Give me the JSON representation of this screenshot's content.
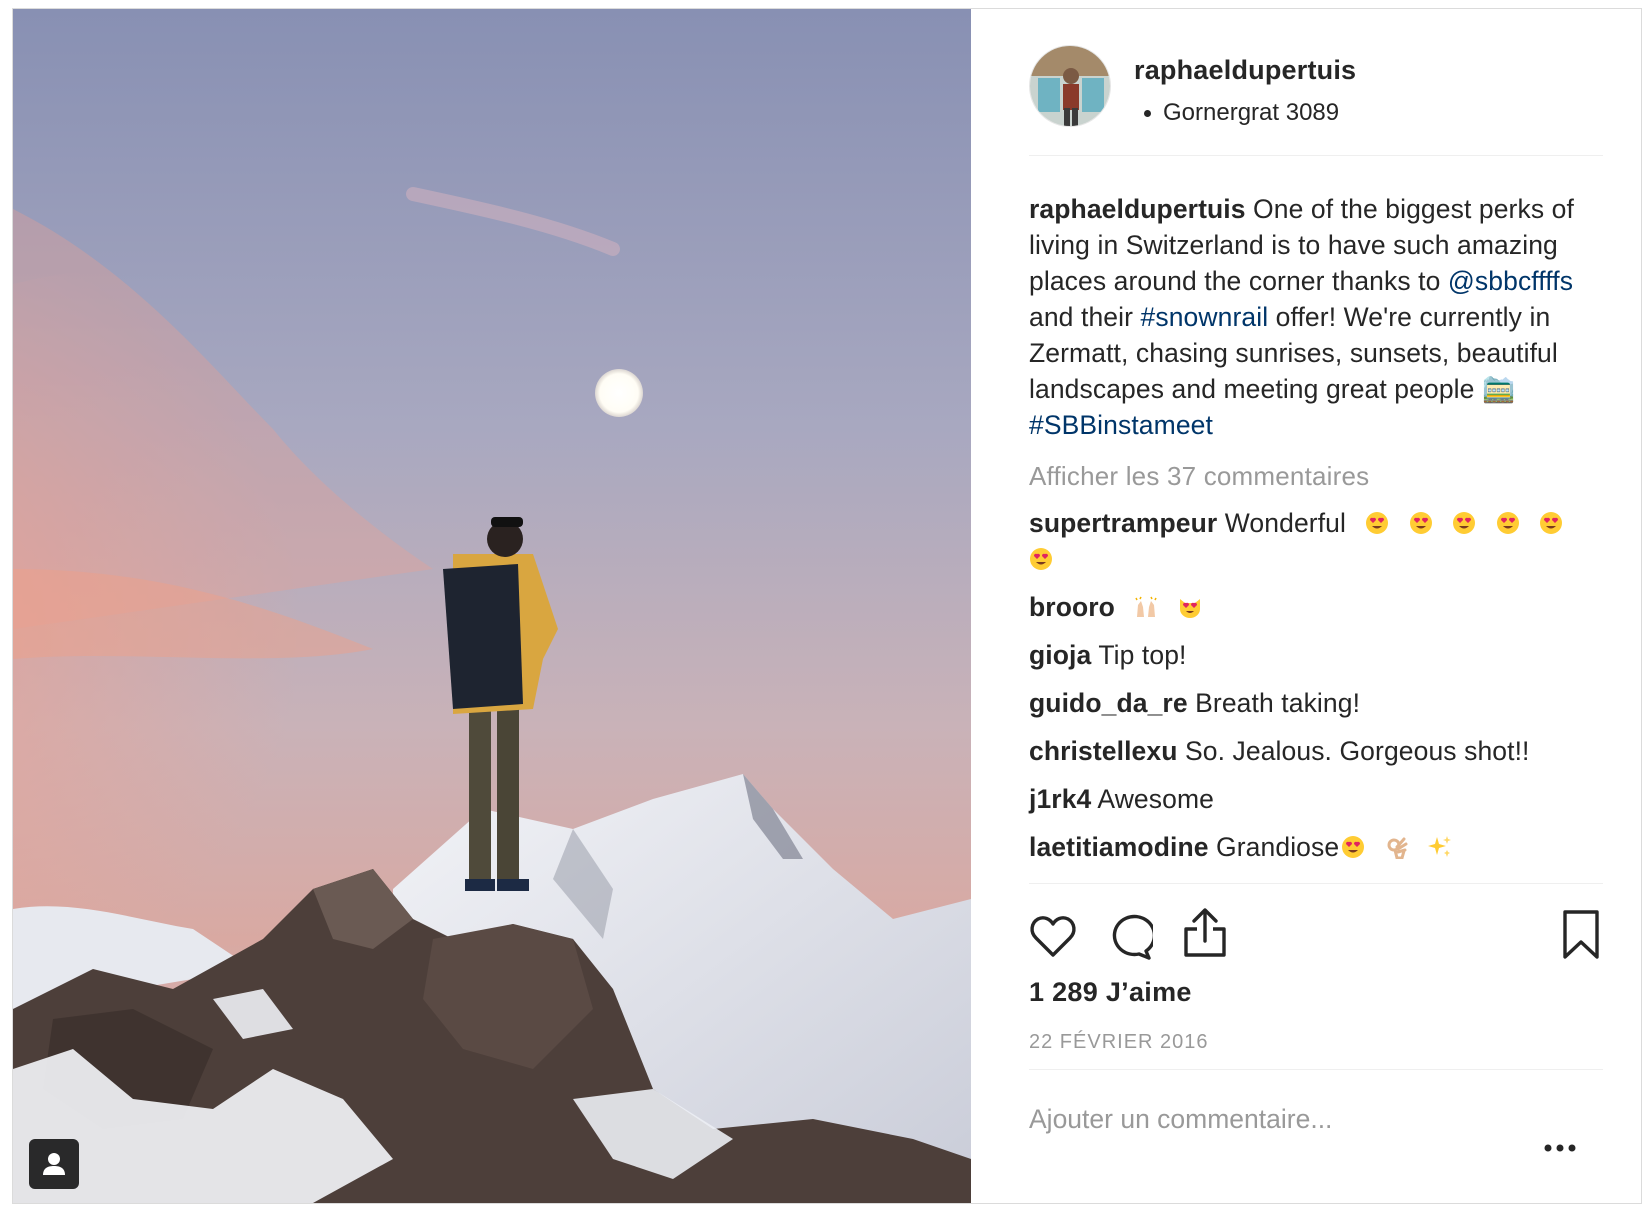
{
  "post": {
    "username": "raphaeldupertuis",
    "location": "Gornergrat 3089",
    "caption": {
      "username": "raphaeldupertuis",
      "text_1": " One of the biggest perks of living in Switzerland is to have such amazing places around the corner thanks to ",
      "mention": "@sbbcffffs",
      "text_2": " and their ",
      "hashtag_1": "#snownrail",
      "text_3": " offer! We're currently in Zermatt, chasing sunrises, sunsets, beautiful landscapes and meeting great people ",
      "emoji": "🚞",
      "text_4": "  ",
      "hashtag_2": "#SBBinstameet"
    },
    "view_all_comments": "Afficher les 37 commentaires",
    "comments": [
      {
        "username": "supertrampeur",
        "text": " Wonderful",
        "emoji": "heart-eyes x6"
      },
      {
        "username": "brooro",
        "text": "",
        "emoji": "raised-hands, heart-eyes-cat"
      },
      {
        "username": "gioja",
        "text": " Tip top!"
      },
      {
        "username": "guido_da_re",
        "text": " Breath taking!"
      },
      {
        "username": "christellexu",
        "text": " So. Jealous. Gorgeous shot!!"
      },
      {
        "username": "j1rk4",
        "text": " Awesome"
      },
      {
        "username": "laetitiamodine",
        "text": " Grandiose",
        "emoji": "heart-eyes, ok-hand, sparkles"
      }
    ],
    "likes": "1 289 J’aime",
    "date": "22 FÉVRIER 2016",
    "add_comment_placeholder": "Ajouter un commentaire..."
  },
  "colors": {
    "text": "#262626",
    "link": "#003569",
    "muted": "#999999",
    "divider": "#efefef"
  },
  "icons": [
    "heart-icon",
    "comment-icon",
    "share-icon",
    "bookmark-icon",
    "more-options-icon",
    "user-tag-icon"
  ]
}
